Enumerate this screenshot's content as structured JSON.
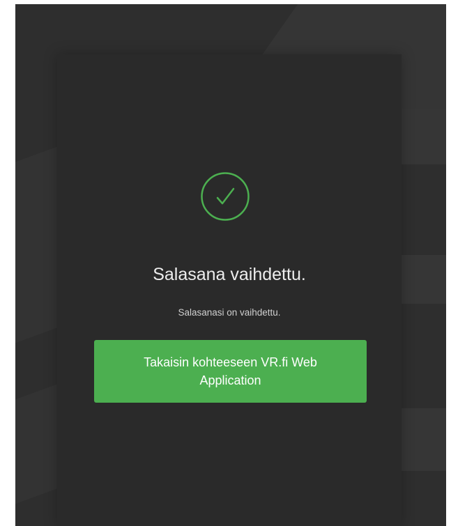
{
  "icon": "checkmark-circle-icon",
  "colors": {
    "accent": "#4caf50",
    "background": "#2e2e2e",
    "card": "#2a2a2a"
  },
  "title": "Salasana vaihdettu.",
  "message": "Salasanasi on vaihdettu.",
  "back_button_label": "Takaisin kohteeseen VR.fi Web Application"
}
